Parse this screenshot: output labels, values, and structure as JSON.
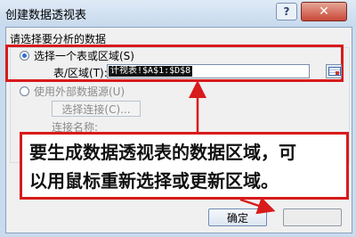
{
  "window": {
    "title": "创建数据透视表",
    "help_glyph": "?",
    "close_glyph": "✕"
  },
  "section": {
    "label": "请选择要分析的数据"
  },
  "options": {
    "select_table": {
      "label": "选择一个表或区域(S)",
      "selected": true
    },
    "range_label": "表/区域(T):",
    "range_value": "计视表!$A$1:$D$8",
    "external": {
      "label": "使用外部数据源(U)",
      "selected": false
    },
    "choose_connection_label": "选择连接(C)...",
    "connection_name_label": "连接名称:"
  },
  "annotation": {
    "line1": "要生成数据透视表的数据区域，可",
    "line2": "以用鼠标重新选择或更新区域。"
  },
  "buttons": {
    "ok": "确定",
    "cancel": ""
  },
  "colors": {
    "highlight": "#d81b1b",
    "selection": "#101010"
  },
  "icons": {
    "picker": "range-picker-icon"
  }
}
